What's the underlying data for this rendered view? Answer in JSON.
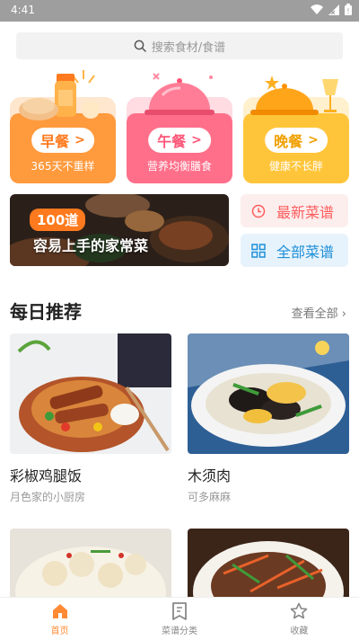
{
  "status_bar": {
    "time": "4:41"
  },
  "search": {
    "placeholder": "搜索食材/食谱"
  },
  "meals": [
    {
      "label": "早餐",
      "sub": "365天不重样",
      "color": "#ff9a3d"
    },
    {
      "label": "午餐",
      "sub": "营养均衡膳食",
      "color": "#ff6f8a"
    },
    {
      "label": "晚餐",
      "sub": "健康不长胖",
      "color": "#ffc53a"
    }
  ],
  "banner": {
    "badge": "100道",
    "caption": "容易上手的家常菜"
  },
  "side_buttons": {
    "latest": {
      "label": "最新菜谱",
      "color": "#ff5c5c"
    },
    "all": {
      "label": "全部菜谱",
      "color": "#1e8fd8"
    }
  },
  "daily": {
    "title": "每日推荐",
    "see_all": "查看全部 ›",
    "recipes": [
      {
        "title": "彩椒鸡腿饭",
        "author": "月色家的小厨房"
      },
      {
        "title": "木须肉",
        "author": "可多麻麻"
      }
    ]
  },
  "tabs": [
    {
      "label": "首页",
      "active": true
    },
    {
      "label": "菜谱分类",
      "active": false
    },
    {
      "label": "收藏",
      "active": false
    }
  ]
}
